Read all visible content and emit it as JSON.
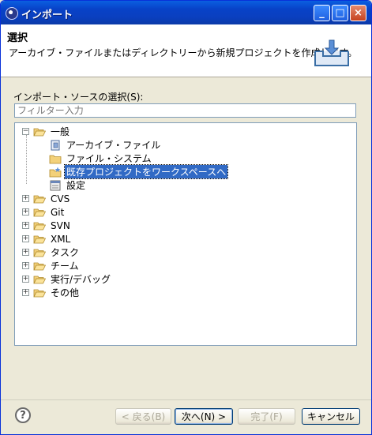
{
  "window": {
    "title": "インポート",
    "controls": {
      "minimize": "_",
      "maximize": "□",
      "close": "×"
    }
  },
  "banner": {
    "title": "選択",
    "description": "アーカイブ・ファイルまたはディレクトリーから新規プロジェクトを作成します。"
  },
  "source": {
    "label": "インポート・ソースの選択(S):",
    "filter_placeholder": "フィルター入力"
  },
  "tree": {
    "general": {
      "label": "一般",
      "twisty": "−",
      "children": [
        {
          "label": "アーカイブ・ファイル",
          "icon": "archive-file-icon"
        },
        {
          "label": "ファイル・システム",
          "icon": "folder-icon"
        },
        {
          "label": "既存プロジェクトをワークスペースへ",
          "icon": "existing-project-icon",
          "selected": true
        },
        {
          "label": "設定",
          "icon": "preferences-icon"
        }
      ]
    },
    "categories": [
      {
        "label": "CVS"
      },
      {
        "label": "Git"
      },
      {
        "label": "SVN"
      },
      {
        "label": "XML"
      },
      {
        "label": "タスク"
      },
      {
        "label": "チーム"
      },
      {
        "label": "実行/デバッグ"
      },
      {
        "label": "その他"
      }
    ],
    "collapsed_twisty": "+"
  },
  "footer": {
    "help": "?",
    "back": "< 戻る(B)",
    "next": "次へ(N) >",
    "finish": "完了(F)",
    "cancel": "キャンセル"
  },
  "colors": {
    "titlebar": "#0a3fbf",
    "selection": "#316ac5",
    "dialog_bg": "#ece9d8"
  }
}
